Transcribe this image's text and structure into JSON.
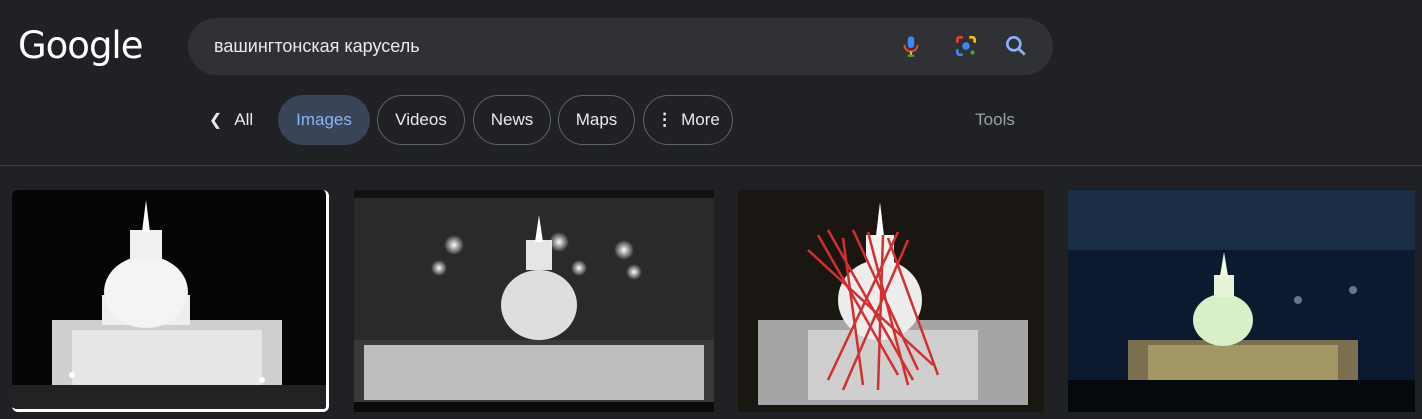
{
  "logo": {
    "text": "Google"
  },
  "search": {
    "query": "вашингтонская карусель"
  },
  "icons": {
    "mic": "microphone-icon",
    "lens": "google-lens-icon",
    "search": "search-icon",
    "back": "chevron-left-icon",
    "more": "vertical-dots-icon"
  },
  "tabs": {
    "all": "All",
    "images": "Images",
    "videos": "Videos",
    "news": "News",
    "maps": "Maps",
    "more": "More",
    "tools": "Tools"
  },
  "colors": {
    "background": "#202124",
    "search_box": "#303134",
    "active_chip_bg": "#394457",
    "active_chip_text": "#8ab4f8",
    "annotation_red": "#d32f2f"
  },
  "results": [
    {
      "id": "capitol-night-bw"
    },
    {
      "id": "capitol-lights-sky"
    },
    {
      "id": "capitol-red-lines"
    },
    {
      "id": "capitol-night-color"
    }
  ]
}
